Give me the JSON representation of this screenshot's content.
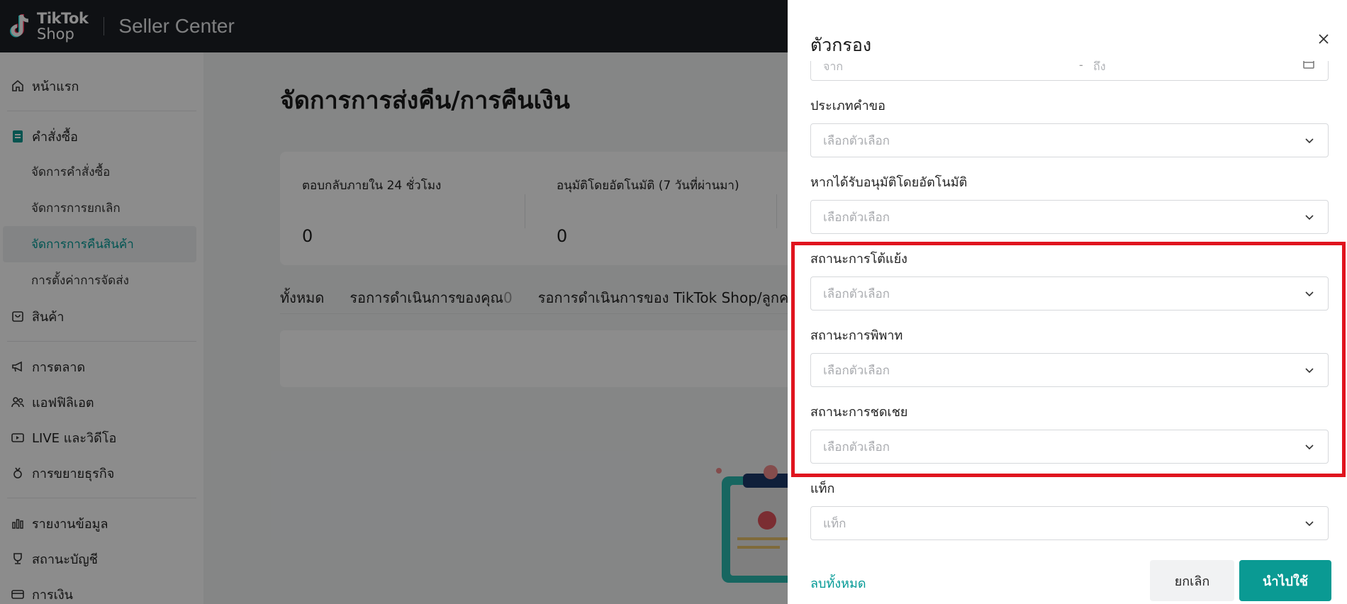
{
  "header": {
    "logo_line1": "TikTok",
    "logo_line2": "Shop",
    "title": "Seller Center"
  },
  "sidebar": {
    "items": [
      {
        "label": "หน้าแรก",
        "icon": "home-icon"
      },
      {
        "label": "คำสั่งซื้อ",
        "icon": "order-icon"
      },
      {
        "label": "จัดการคำสั่งซื้อ"
      },
      {
        "label": "จัดการการยกเลิก"
      },
      {
        "label": "จัดการการคืนสินค้า"
      },
      {
        "label": "การตั้งค่าการจัดส่ง"
      },
      {
        "label": "สินค้า",
        "icon": "bag-icon"
      },
      {
        "label": "การตลาด",
        "icon": "megaphone-icon"
      },
      {
        "label": "แอฟฟิลิเอต",
        "icon": "people-icon"
      },
      {
        "label": "LIVE และวิดีโอ",
        "icon": "video-icon"
      },
      {
        "label": "การขยายธุรกิจ",
        "icon": "medal-icon"
      },
      {
        "label": "รายงานข้อมูล",
        "icon": "chart-icon"
      },
      {
        "label": "สถานะบัญชี",
        "icon": "trophy-icon"
      },
      {
        "label": "การเงิน",
        "icon": "wallet-icon"
      }
    ]
  },
  "main": {
    "page_title": "จัดการการส่งคืน/การคืนเงิน",
    "stats": [
      {
        "label": "ตอบกลับภายใน 24 ชั่วโมง",
        "value": "0"
      },
      {
        "label": "อนุมัติโดยอัตโนมัติ (7 วันที่ผ่านมา)",
        "value": "0"
      }
    ],
    "tabs": [
      {
        "label": "ทั้งหมด"
      },
      {
        "label": "รอการดำเนินการของคุณ",
        "count": "0"
      },
      {
        "label": "รอการดำเนินการของ TikTok Shop/ลูกค"
      }
    ]
  },
  "drawer": {
    "title": "ตัวกรอง",
    "date_from_placeholder": "จาก",
    "date_separator": "-",
    "date_to_placeholder": "ถึง",
    "fields": [
      {
        "label": "ประเภทคำขอ",
        "placeholder": "เลือกตัวเลือก"
      },
      {
        "label": "หากได้รับอนุมัติโดยอัตโนมัติ",
        "placeholder": "เลือกตัวเลือก"
      },
      {
        "label": "สถานะการโต้แย้ง",
        "placeholder": "เลือกตัวเลือก"
      },
      {
        "label": "สถานะการพิพาท",
        "placeholder": "เลือกตัวเลือก"
      },
      {
        "label": "สถานะการชดเชย",
        "placeholder": "เลือกตัวเลือก"
      },
      {
        "label": "แท็ก",
        "placeholder": "แท็ก"
      }
    ],
    "clear_all": "ลบทั้งหมด",
    "cancel": "ยกเลิก",
    "apply": "นำไปใช้"
  },
  "colors": {
    "accent": "#009995",
    "apply_button": "#0a9a93",
    "highlight": "#e0141e",
    "topbar": "#1d2026"
  }
}
